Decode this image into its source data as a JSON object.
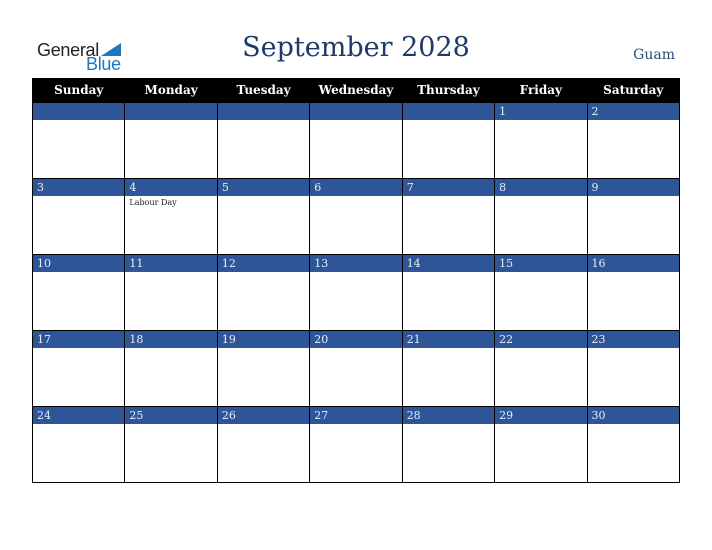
{
  "logo": {
    "general": "General",
    "blue": "Blue"
  },
  "title": "September 2028",
  "region": "Guam",
  "weekdays": [
    "Sunday",
    "Monday",
    "Tuesday",
    "Wednesday",
    "Thursday",
    "Friday",
    "Saturday"
  ],
  "colors": {
    "header_bg": "#000000",
    "date_band": "#2e5597",
    "title": "#1f3a68",
    "logo_blue": "#1c78c0"
  },
  "weeks": [
    [
      {
        "day": "",
        "note": ""
      },
      {
        "day": "",
        "note": ""
      },
      {
        "day": "",
        "note": ""
      },
      {
        "day": "",
        "note": ""
      },
      {
        "day": "",
        "note": ""
      },
      {
        "day": "1",
        "note": ""
      },
      {
        "day": "2",
        "note": ""
      }
    ],
    [
      {
        "day": "3",
        "note": ""
      },
      {
        "day": "4",
        "note": "Labour Day"
      },
      {
        "day": "5",
        "note": ""
      },
      {
        "day": "6",
        "note": ""
      },
      {
        "day": "7",
        "note": ""
      },
      {
        "day": "8",
        "note": ""
      },
      {
        "day": "9",
        "note": ""
      }
    ],
    [
      {
        "day": "10",
        "note": ""
      },
      {
        "day": "11",
        "note": ""
      },
      {
        "day": "12",
        "note": ""
      },
      {
        "day": "13",
        "note": ""
      },
      {
        "day": "14",
        "note": ""
      },
      {
        "day": "15",
        "note": ""
      },
      {
        "day": "16",
        "note": ""
      }
    ],
    [
      {
        "day": "17",
        "note": ""
      },
      {
        "day": "18",
        "note": ""
      },
      {
        "day": "19",
        "note": ""
      },
      {
        "day": "20",
        "note": ""
      },
      {
        "day": "21",
        "note": ""
      },
      {
        "day": "22",
        "note": ""
      },
      {
        "day": "23",
        "note": ""
      }
    ],
    [
      {
        "day": "24",
        "note": ""
      },
      {
        "day": "25",
        "note": ""
      },
      {
        "day": "26",
        "note": ""
      },
      {
        "day": "27",
        "note": ""
      },
      {
        "day": "28",
        "note": ""
      },
      {
        "day": "29",
        "note": ""
      },
      {
        "day": "30",
        "note": ""
      }
    ]
  ]
}
